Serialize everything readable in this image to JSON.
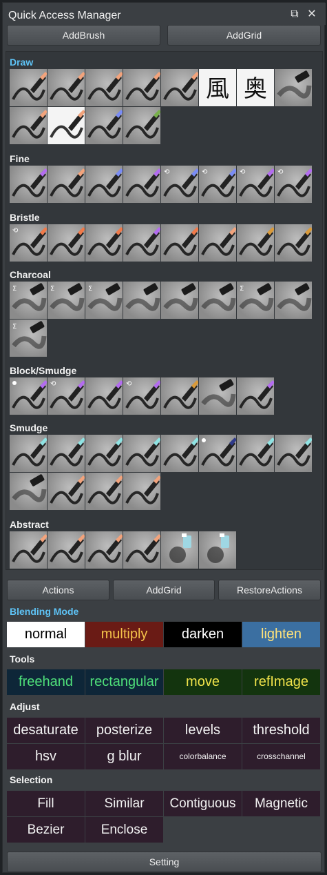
{
  "window": {
    "title": "Quick Access Manager",
    "restore_icon": "restore-window-icon",
    "close_icon": "close-icon",
    "restore_glyph": "⧉",
    "close_glyph": "✕"
  },
  "top_buttons": {
    "add_brush": "AddBrush",
    "add_grid": "AddGrid"
  },
  "brush_categories": [
    {
      "label": "Draw",
      "tiles": [
        "pen-ink-stroke",
        "pen-ink-loop",
        "pen-curve",
        "pen-wave",
        "pen-hatch",
        "calligraphy-kanji",
        "calligraphy-kanji-bold",
        "pencil-smear",
        "marker-stroke",
        "brush-v-stroke",
        "pencil-blue-squiggle",
        "brush-green-tip"
      ]
    },
    {
      "label": "Fine",
      "tiles": [
        "fine-purple-pen",
        "fine-pink-pen",
        "fine-airbrush-blue",
        "fine-airbrush-violet",
        "fine-liner-blue-rotate",
        "fine-liner-blue-rotate-2",
        "fine-pencil-violet-rotate",
        "fine-pencil-violet-rotate-2"
      ]
    },
    {
      "label": "Bristle",
      "tiles": [
        "bristle-orange-rotate",
        "bristle-orange",
        "bristle-orange-2",
        "bristle-purple",
        "bristle-orange-3",
        "bristle-ink-pen",
        "bristle-fan-gold",
        "bristle-fan-gold-2"
      ]
    },
    {
      "label": "Charcoal",
      "tiles": [
        "charcoal-sigma-1",
        "charcoal-sigma-2",
        "charcoal-sigma-3",
        "charcoal-stick-1",
        "charcoal-stick-2",
        "charcoal-stick-3",
        "charcoal-sigma-4",
        "charcoal-block",
        "charcoal-block-sigma"
      ]
    },
    {
      "label": "Block/Smudge",
      "tiles": [
        "block-dot-purple",
        "block-rotate-purple",
        "block-purple-blend",
        "block-rotate-purple-2",
        "block-fan-gold",
        "block-rock-smudge",
        "block-purple-stick"
      ]
    },
    {
      "label": "Smudge",
      "tiles": [
        "smudge-teal-1",
        "smudge-teal-2",
        "smudge-teal-3",
        "smudge-teal-4",
        "smudge-teal-5",
        "smudge-navy-dot",
        "smudge-teal-6",
        "smudge-teal-7",
        "smudge-teal-noise",
        "smudge-water-pencil",
        "smudge-finger",
        "smudge-white-brush"
      ]
    },
    {
      "label": "Abstract",
      "tiles": [
        "abstract-pen-1",
        "abstract-pen-2",
        "abstract-pen-3",
        "abstract-pen-4",
        "abstract-spray-1",
        "abstract-spray-2"
      ]
    }
  ],
  "action_buttons": {
    "actions": "Actions",
    "add_grid": "AddGrid",
    "restore_actions": "RestoreActions"
  },
  "blending_mode": {
    "header": "Blending Mode",
    "items": [
      {
        "label": "normal",
        "bg": "#ffffff",
        "fg": "#000000"
      },
      {
        "label": "multiply",
        "bg": "#6a1b15",
        "fg": "#f3c14a"
      },
      {
        "label": "darken",
        "bg": "#000000",
        "fg": "#ffffff"
      },
      {
        "label": "lighten",
        "bg": "#3b6fa1",
        "fg": "#ffe27a"
      }
    ]
  },
  "tools": {
    "header": "Tools",
    "items": [
      {
        "label": "freehand",
        "bg": "#0e2638",
        "fg": "#4fe07a"
      },
      {
        "label": "rectangular",
        "bg": "#0e2638",
        "fg": "#4fe07a"
      },
      {
        "label": "move",
        "bg": "#13340e",
        "fg": "#f0e34a"
      },
      {
        "label": "refImage",
        "bg": "#13340e",
        "fg": "#f0e34a"
      }
    ]
  },
  "adjust": {
    "header": "Adjust",
    "row1": [
      "desaturate",
      "posterize",
      "levels",
      "threshold"
    ],
    "row2": [
      "hsv",
      "g blur",
      "colorbalance",
      "crosschannel"
    ],
    "bg": "#2e1d2c",
    "fg": "#f2f2f2"
  },
  "selection": {
    "header": "Selection",
    "row1": [
      "Fill",
      "Similar",
      "Contiguous",
      "Magnetic"
    ],
    "row2": [
      "Bezier",
      "Enclose"
    ],
    "bg": "#2e1d2c",
    "fg": "#f2f2f2"
  },
  "setting": "Setting",
  "colors": {
    "panel": "#3b3f43",
    "accent_header": "#5ec3f6"
  }
}
